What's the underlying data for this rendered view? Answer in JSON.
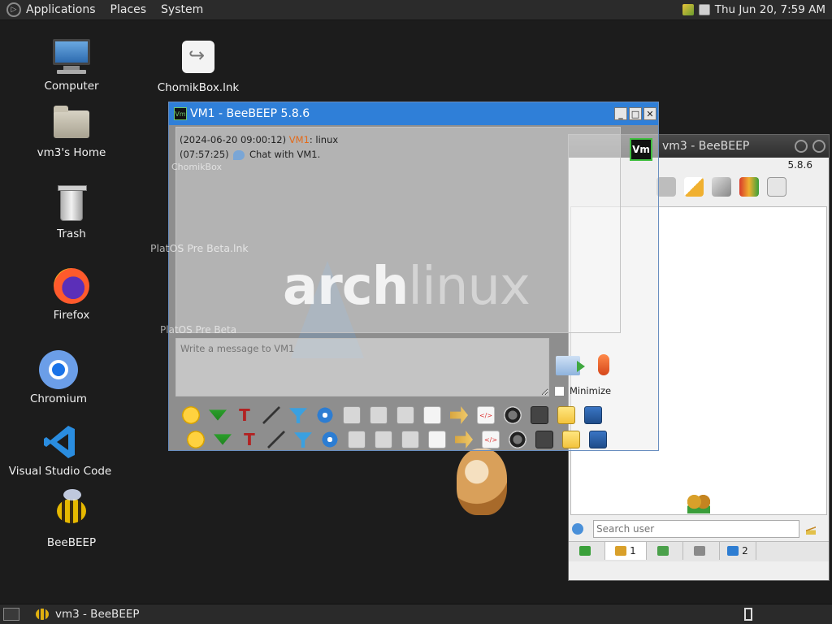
{
  "topbar": {
    "menus": [
      "Applications",
      "Places",
      "System"
    ],
    "clock": "Thu Jun 20,  7:59 AM"
  },
  "desktop": {
    "icons": [
      {
        "label": "Computer",
        "icon": "computer-icon"
      },
      {
        "label": "vm3's Home",
        "icon": "home-folder-icon"
      },
      {
        "label": "Trash",
        "icon": "trash-icon"
      },
      {
        "label": "Firefox",
        "icon": "firefox-icon"
      },
      {
        "label": "Chromium",
        "icon": "chromium-icon"
      },
      {
        "label": "Visual Studio Code",
        "icon": "vscode-icon"
      },
      {
        "label": "BeeBEEP",
        "icon": "beebeep-icon"
      },
      {
        "label": "ChomikBox.lnk",
        "icon": "shortcut-icon"
      }
    ],
    "ghost_labels": [
      "ChomikBox",
      "PlatOS Pre Beta.lnk",
      "PlatOS Pre Beta"
    ],
    "wallpaper_text": {
      "bold": "arch",
      "light": "linux"
    }
  },
  "main_window": {
    "title": "VM1 - BeeBEEP 5.8.6",
    "app_icon_text": "Vm",
    "chat": {
      "line1_time": "(2024-06-20 09:00:12)",
      "line1_user": "VM1",
      "line1_text": ": linux",
      "line2_time": "(07:57:25)",
      "line2_text": "Chat with VM1."
    },
    "avatar_text": "Vm",
    "message_placeholder": "Write a message to VM1",
    "minimize_label": "Minimize"
  },
  "side_window": {
    "title": "vm3 - BeeBEEP",
    "version": "5.8.6",
    "search_placeholder": "Search user",
    "tabs": [
      {
        "count": "1",
        "icon": "users-icon"
      },
      {
        "count": "",
        "icon": "chats-icon"
      },
      {
        "count": "",
        "icon": "groups-icon"
      },
      {
        "count": "2",
        "icon": "network-icon"
      }
    ]
  },
  "taskbar": {
    "task_label": "vm3 - BeeBEEP"
  },
  "colors": {
    "title_active": "#2f7fd8",
    "username": "#e36a1a",
    "desktop_bg": "#1c1c1c"
  }
}
